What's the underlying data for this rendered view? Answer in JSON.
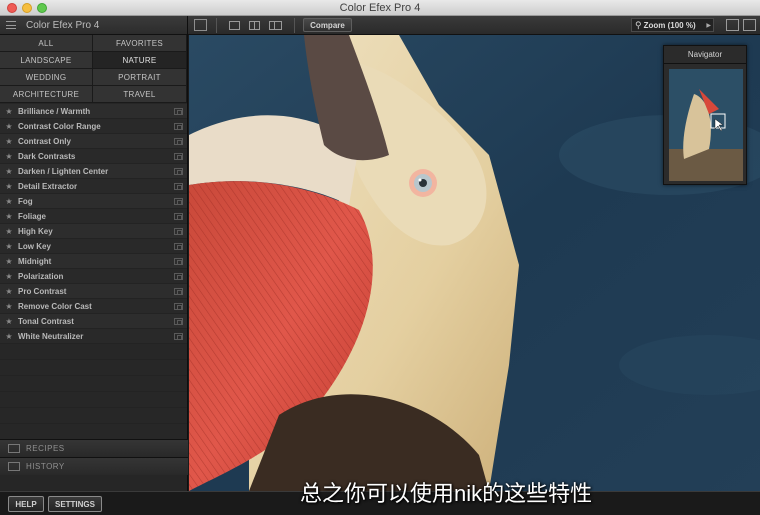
{
  "window": {
    "title": "Color Efex Pro 4"
  },
  "sidebar": {
    "app_name": "Color Efex Pro 4",
    "categories": [
      "ALL",
      "FAVORITES",
      "LANDSCAPE",
      "NATURE",
      "WEDDING",
      "PORTRAIT",
      "ARCHITECTURE",
      "TRAVEL"
    ],
    "active_category": "NATURE",
    "filters": [
      "Brilliance / Warmth",
      "Contrast Color Range",
      "Contrast Only",
      "Dark Contrasts",
      "Darken / Lighten Center",
      "Detail Extractor",
      "Fog",
      "Foliage",
      "High Key",
      "Low Key",
      "Midnight",
      "Polarization",
      "Pro Contrast",
      "Remove Color Cast",
      "Tonal Contrast",
      "White Neutralizer"
    ],
    "recipes_label": "RECIPES",
    "history_label": "HISTORY"
  },
  "toolbar": {
    "compare_label": "Compare",
    "zoom_label": "Zoom (100 %)"
  },
  "navigator": {
    "title": "Navigator"
  },
  "bottom": {
    "help_label": "HELP",
    "settings_label": "SETTINGS"
  },
  "subtitle": "总之你可以使用nik的这些特性",
  "colors": {
    "background": "#1b1b1b",
    "sidebar": "#262626",
    "water": "#1e3a52",
    "pouch": "#d8483a"
  }
}
